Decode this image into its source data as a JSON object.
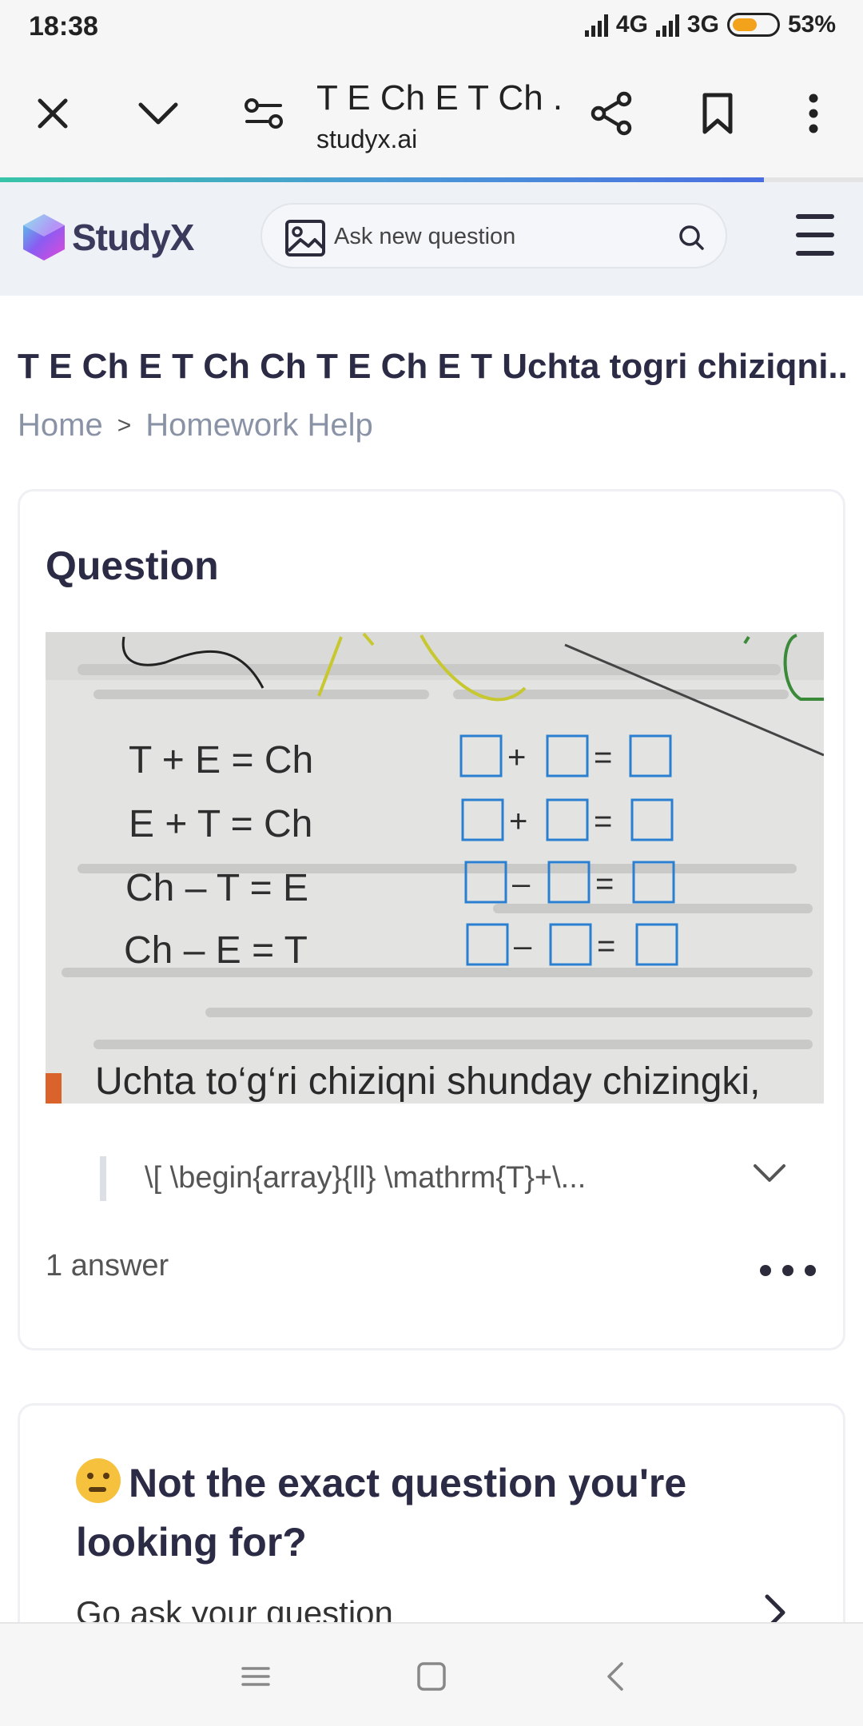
{
  "status": {
    "time": "18:38",
    "network1": "4G",
    "network2": "3G",
    "battery": "53%",
    "battery_level": 0.53
  },
  "browser": {
    "tab_title": "T E Ch E T Ch ...",
    "domain": "studyx.ai",
    "load_progress": 0.885
  },
  "site": {
    "logo_text": "StudyX",
    "search_placeholder": "Ask new question"
  },
  "page": {
    "title": "T E Ch E T Ch Ch T E Ch E T Uchta togri chiziqni...",
    "breadcrumb": [
      "Home",
      "Homework Help"
    ]
  },
  "question": {
    "heading": "Question",
    "image": {
      "equations": [
        "T + E = Ch",
        "E + T = Ch",
        "Ch – T = E",
        "Ch – E = T"
      ],
      "operators": [
        "+",
        "+",
        "–",
        "–"
      ],
      "caption": "Uchta to‘g‘ri chiziqni shunday chizingki,"
    },
    "latex_preview": "\\[ \\begin{array}{ll} \\mathrm{T}+\\...",
    "answer_count": "1 answer"
  },
  "not_exact": {
    "title": "Not the exact question you're looking for?",
    "link": "Go ask your question"
  },
  "colors": {
    "accent": "#2b2b46",
    "progress_start": "#37c4a8",
    "progress_end": "#4a6ee0",
    "battery": "#f2a21b",
    "box_blue": "#2a7fd0"
  }
}
